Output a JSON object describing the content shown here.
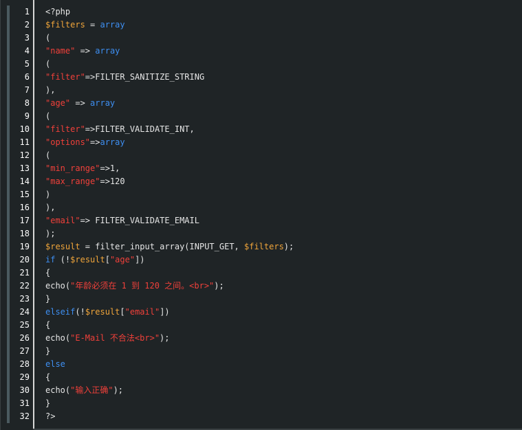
{
  "editor": {
    "colors": {
      "background": "#1f2426",
      "plain": "#e6e6e6",
      "variable": "#f0a53a",
      "keyword": "#3e8ff2",
      "string": "#f0403a",
      "line_number": "#ffffff"
    },
    "lines": [
      {
        "n": "1",
        "tokens": [
          {
            "t": "plain",
            "v": "<?php"
          }
        ]
      },
      {
        "n": "2",
        "tokens": [
          {
            "t": "var",
            "v": "$filters"
          },
          {
            "t": "plain",
            "v": " = "
          },
          {
            "t": "kw",
            "v": "array"
          }
        ]
      },
      {
        "n": "3",
        "tokens": [
          {
            "t": "plain",
            "v": "("
          }
        ]
      },
      {
        "n": "4",
        "tokens": [
          {
            "t": "str",
            "v": "\"name\""
          },
          {
            "t": "plain",
            "v": " => "
          },
          {
            "t": "kw",
            "v": "array"
          }
        ]
      },
      {
        "n": "5",
        "tokens": [
          {
            "t": "plain",
            "v": "("
          }
        ]
      },
      {
        "n": "6",
        "tokens": [
          {
            "t": "str",
            "v": "\"filter\""
          },
          {
            "t": "plain",
            "v": "=>FILTER_SANITIZE_STRING"
          }
        ]
      },
      {
        "n": "7",
        "tokens": [
          {
            "t": "plain",
            "v": "),"
          }
        ]
      },
      {
        "n": "8",
        "tokens": [
          {
            "t": "str",
            "v": "\"age\""
          },
          {
            "t": "plain",
            "v": " => "
          },
          {
            "t": "kw",
            "v": "array"
          }
        ]
      },
      {
        "n": "9",
        "tokens": [
          {
            "t": "plain",
            "v": "("
          }
        ]
      },
      {
        "n": "10",
        "tokens": [
          {
            "t": "str",
            "v": "\"filter\""
          },
          {
            "t": "plain",
            "v": "=>FILTER_VALIDATE_INT,"
          }
        ]
      },
      {
        "n": "11",
        "tokens": [
          {
            "t": "str",
            "v": "\"options\""
          },
          {
            "t": "plain",
            "v": "=>"
          },
          {
            "t": "kw",
            "v": "array"
          }
        ]
      },
      {
        "n": "12",
        "tokens": [
          {
            "t": "plain",
            "v": "("
          }
        ]
      },
      {
        "n": "13",
        "tokens": [
          {
            "t": "str",
            "v": "\"min_range\""
          },
          {
            "t": "plain",
            "v": "=>1,"
          }
        ]
      },
      {
        "n": "14",
        "tokens": [
          {
            "t": "str",
            "v": "\"max_range\""
          },
          {
            "t": "plain",
            "v": "=>120"
          }
        ]
      },
      {
        "n": "15",
        "tokens": [
          {
            "t": "plain",
            "v": ")"
          }
        ]
      },
      {
        "n": "16",
        "tokens": [
          {
            "t": "plain",
            "v": "),"
          }
        ]
      },
      {
        "n": "17",
        "tokens": [
          {
            "t": "str",
            "v": "\"email\""
          },
          {
            "t": "plain",
            "v": "=> FILTER_VALIDATE_EMAIL"
          }
        ]
      },
      {
        "n": "18",
        "tokens": [
          {
            "t": "plain",
            "v": ");"
          }
        ]
      },
      {
        "n": "19",
        "tokens": [
          {
            "t": "var",
            "v": "$result"
          },
          {
            "t": "plain",
            "v": " = filter_input_array(INPUT_GET, "
          },
          {
            "t": "var",
            "v": "$filters"
          },
          {
            "t": "plain",
            "v": ");"
          }
        ]
      },
      {
        "n": "20",
        "tokens": [
          {
            "t": "kw",
            "v": "if"
          },
          {
            "t": "plain",
            "v": " (!"
          },
          {
            "t": "var",
            "v": "$result"
          },
          {
            "t": "plain",
            "v": "["
          },
          {
            "t": "str",
            "v": "\"age\""
          },
          {
            "t": "plain",
            "v": "])"
          }
        ]
      },
      {
        "n": "21",
        "tokens": [
          {
            "t": "plain",
            "v": "{"
          }
        ]
      },
      {
        "n": "22",
        "tokens": [
          {
            "t": "plain",
            "v": "echo("
          },
          {
            "t": "str",
            "v": "\"年龄必须在 1 到 120 之间。<br>\""
          },
          {
            "t": "plain",
            "v": ");"
          }
        ]
      },
      {
        "n": "23",
        "tokens": [
          {
            "t": "plain",
            "v": "}"
          }
        ]
      },
      {
        "n": "24",
        "tokens": [
          {
            "t": "kw",
            "v": "elseif"
          },
          {
            "t": "plain",
            "v": "(!"
          },
          {
            "t": "var",
            "v": "$result"
          },
          {
            "t": "plain",
            "v": "["
          },
          {
            "t": "str",
            "v": "\"email\""
          },
          {
            "t": "plain",
            "v": "])"
          }
        ]
      },
      {
        "n": "25",
        "tokens": [
          {
            "t": "plain",
            "v": "{"
          }
        ]
      },
      {
        "n": "26",
        "tokens": [
          {
            "t": "plain",
            "v": "echo("
          },
          {
            "t": "str",
            "v": "\"E-Mail 不合法<br>\""
          },
          {
            "t": "plain",
            "v": ");"
          }
        ]
      },
      {
        "n": "27",
        "tokens": [
          {
            "t": "plain",
            "v": "}"
          }
        ]
      },
      {
        "n": "28",
        "tokens": [
          {
            "t": "kw",
            "v": "else"
          }
        ]
      },
      {
        "n": "29",
        "tokens": [
          {
            "t": "plain",
            "v": "{"
          }
        ]
      },
      {
        "n": "30",
        "tokens": [
          {
            "t": "plain",
            "v": "echo("
          },
          {
            "t": "str",
            "v": "\"输入正确\""
          },
          {
            "t": "plain",
            "v": ");"
          }
        ]
      },
      {
        "n": "31",
        "tokens": [
          {
            "t": "plain",
            "v": "}"
          }
        ]
      },
      {
        "n": "32",
        "tokens": [
          {
            "t": "plain",
            "v": "?>"
          }
        ]
      }
    ]
  }
}
